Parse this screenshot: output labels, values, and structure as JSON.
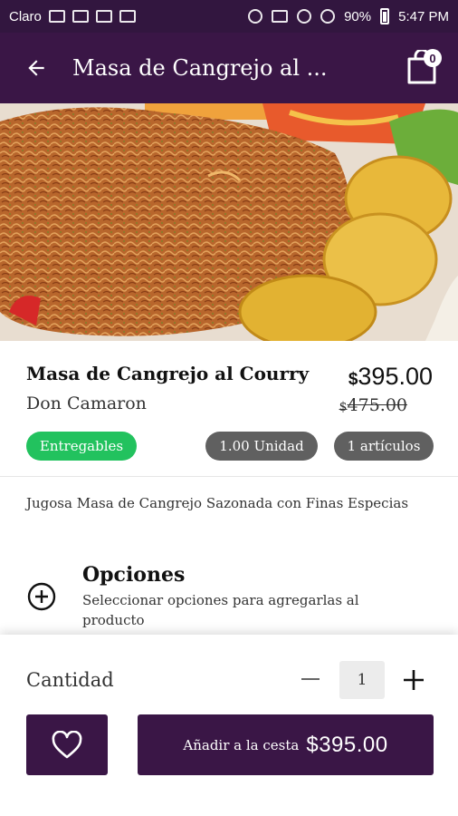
{
  "status_bar": {
    "carrier": "Claro",
    "battery": "90%",
    "time": "5:47 PM"
  },
  "header": {
    "title": "Masa de Cangrejo al ...",
    "cart_count": "0",
    "back_icon": "back-arrow-icon",
    "cart_icon": "shopping-bag-icon"
  },
  "product": {
    "name": "Masa de Cangrejo al Courry",
    "vendor": "Don Camaron",
    "currency": "$",
    "price": "395.00",
    "old_price": "475.00",
    "badges": {
      "delivery": "Entregables",
      "unit": "1.00 Unidad",
      "items": "1 artículos"
    },
    "description": "Jugosa Masa de Cangrejo Sazonada con Finas Especias"
  },
  "options": {
    "title": "Opciones",
    "subtitle": "Seleccionar opciones para agregarlas al producto",
    "icon": "plus-circle-icon"
  },
  "footer": {
    "quantity_label": "Cantidad",
    "quantity": "1",
    "add_label": "Añadir a la cesta",
    "add_amount": "$395.00",
    "favorite_icon": "heart-icon"
  },
  "colors": {
    "brand": "#3a1646",
    "status_bar": "#32163f",
    "delivery_badge": "#22c25e",
    "gray_badge": "#606060"
  }
}
